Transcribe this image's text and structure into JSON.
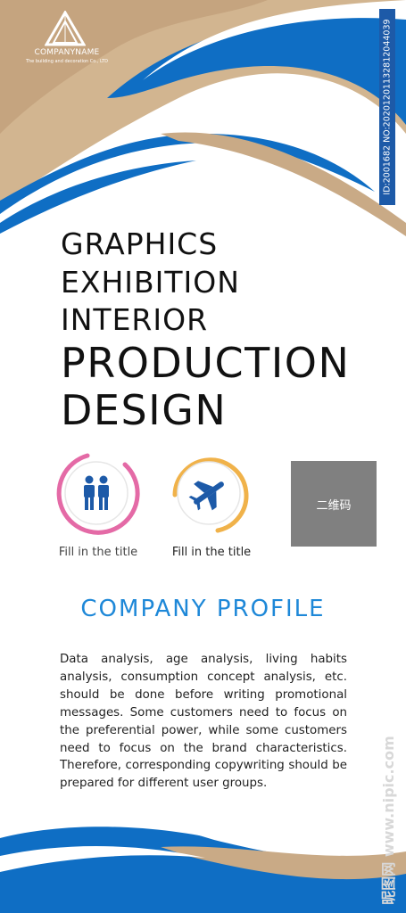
{
  "brand": {
    "company_name": "COMPANYNAME",
    "company_sub": "The building and decoration Co., LTD"
  },
  "id_strip": "ID:2001682 NO:20201201132812044039",
  "headline": {
    "line1": "GRAPHICS",
    "line2": "EXHIBITION",
    "line3": "INTERIOR",
    "line4": "PRODUCTION",
    "line5": "DESIGN"
  },
  "features": [
    {
      "caption": "Fill in the title",
      "icon": "people-icon",
      "ring_color": "#e46aa6"
    },
    {
      "caption": "Fill in the title",
      "icon": "airplane-icon",
      "ring_color": "#f0b24a"
    }
  ],
  "qr_label": "二维码",
  "profile": {
    "title": "COMPANY PROFILE",
    "text": "Data analysis, age analysis, living habits analysis, consumption concept analysis, etc. should be done before writing promotional messages. Some customers need to focus on the preferential power, while some customers need to focus on the brand characteristics. Therefore, corresponding copywriting should be prepared for different user groups."
  },
  "watermark": "昵图网 www.nipic.com",
  "colors": {
    "blue": "#0f6ec4",
    "tan": "#c9aa86",
    "accent": "#1e88d8"
  }
}
